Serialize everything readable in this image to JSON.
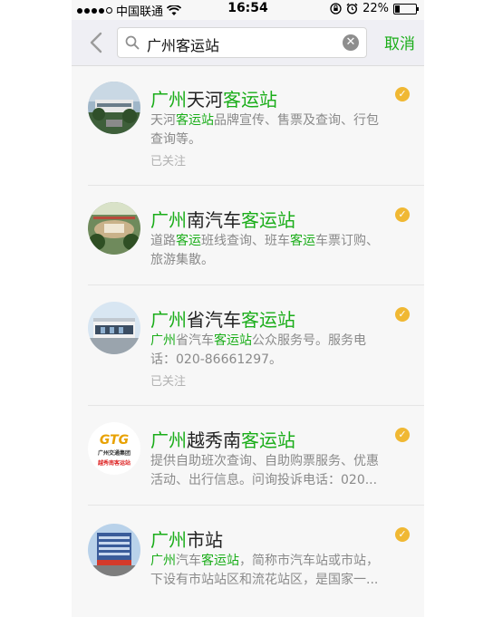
{
  "status": {
    "carrier": "中国联通",
    "time": "16:54",
    "battery": "22%",
    "battery_level": 0.22
  },
  "search": {
    "query": "广州客运站",
    "cancel": "取消"
  },
  "results": [
    {
      "title": [
        {
          "t": "广州",
          "h": true
        },
        {
          "t": "天河",
          "h": false
        },
        {
          "t": "客运站",
          "h": true
        }
      ],
      "desc": [
        {
          "t": "天河",
          "h": false
        },
        {
          "t": "客运站",
          "h": true
        },
        {
          "t": "品牌宣传、售票及查询、行包",
          "h": false
        },
        {
          "t": "\n查询等。",
          "h": false
        }
      ],
      "followed": "已关注"
    },
    {
      "title": [
        {
          "t": "广州",
          "h": true
        },
        {
          "t": "南汽车",
          "h": false
        },
        {
          "t": "客运站",
          "h": true
        }
      ],
      "desc": [
        {
          "t": "道路",
          "h": false
        },
        {
          "t": "客运",
          "h": true
        },
        {
          "t": "班线查询、班车",
          "h": false
        },
        {
          "t": "客运",
          "h": true
        },
        {
          "t": "车票订购、",
          "h": false
        },
        {
          "t": "\n旅游集散。",
          "h": false
        }
      ],
      "followed": ""
    },
    {
      "title": [
        {
          "t": "广州",
          "h": true
        },
        {
          "t": "省汽车",
          "h": false
        },
        {
          "t": "客运站",
          "h": true
        }
      ],
      "desc": [
        {
          "t": "广州",
          "h": true
        },
        {
          "t": "省汽车",
          "h": false
        },
        {
          "t": "客运站",
          "h": true
        },
        {
          "t": "公众服务号。服务电",
          "h": false
        },
        {
          "t": "\n话：020-86661297。",
          "h": false
        }
      ],
      "followed": "已关注"
    },
    {
      "title": [
        {
          "t": "广州",
          "h": true
        },
        {
          "t": "越秀南",
          "h": false
        },
        {
          "t": "客运站",
          "h": true
        }
      ],
      "desc": [
        {
          "t": "提供自助班次查询、自助购票服务、优惠\n活动、出行信息。问询投诉电话：020...",
          "h": false
        }
      ],
      "followed": "",
      "logo_text": "GTG",
      "logo_sub1": "广州交通集团",
      "logo_sub2": "越秀南客运站"
    },
    {
      "title": [
        {
          "t": "广州",
          "h": true
        },
        {
          "t": "市站",
          "h": false
        }
      ],
      "desc": [
        {
          "t": "广州",
          "h": true
        },
        {
          "t": "汽车",
          "h": false
        },
        {
          "t": "客运站",
          "h": true
        },
        {
          "t": "，简称市汽车站或市站，\n下设有市站站区和流花站区，是国家一...",
          "h": false
        }
      ],
      "followed": ""
    }
  ]
}
